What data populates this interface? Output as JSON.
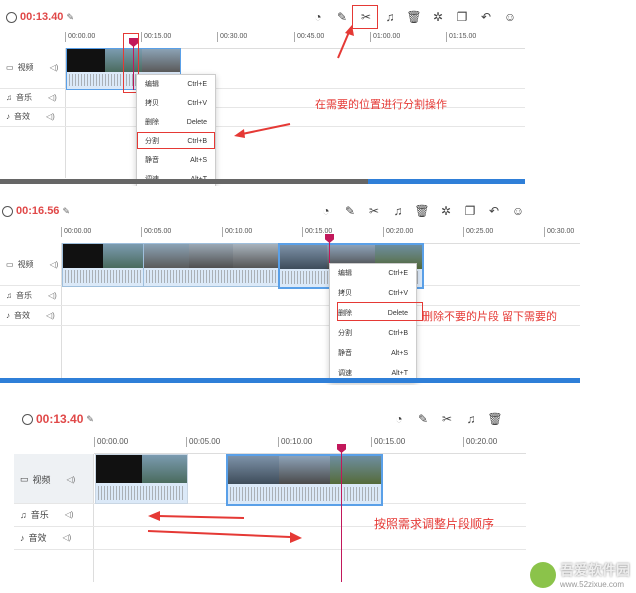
{
  "panel1": {
    "time": "00:13.40",
    "ticks": [
      "00:00.00",
      "00:15.00",
      "00:30.00",
      "00:45.00",
      "01:00.00",
      "01:15.00"
    ],
    "tracks": [
      {
        "label": "视频",
        "icon": "video-icon"
      },
      {
        "label": "音乐",
        "icon": "music-icon"
      },
      {
        "label": "音效",
        "icon": "sound-effect-icon"
      }
    ],
    "menu": [
      {
        "label": "编辑",
        "key": "Ctrl+E"
      },
      {
        "label": "拷贝",
        "key": "Ctrl+V"
      },
      {
        "label": "删除",
        "key": "Delete"
      },
      {
        "label": "分割",
        "key": "Ctrl+B"
      },
      {
        "label": "静音",
        "key": "Alt+S"
      },
      {
        "label": "调速",
        "key": "Alt+T"
      }
    ],
    "annotation": "在需要的位置进行分割操作"
  },
  "panel2": {
    "time": "00:16.56",
    "ticks": [
      "00:00.00",
      "00:05.00",
      "00:10.00",
      "00:15.00",
      "00:20.00",
      "00:25.00",
      "00:30.00"
    ],
    "tracks": [
      {
        "label": "视频",
        "icon": "video-icon"
      },
      {
        "label": "音乐",
        "icon": "music-icon"
      },
      {
        "label": "音效",
        "icon": "sound-effect-icon"
      }
    ],
    "menu": [
      {
        "label": "编辑",
        "key": "Ctrl+E"
      },
      {
        "label": "拷贝",
        "key": "Ctrl+V"
      },
      {
        "label": "删除",
        "key": "Delete"
      },
      {
        "label": "分割",
        "key": "Ctrl+B"
      },
      {
        "label": "静音",
        "key": "Alt+S"
      },
      {
        "label": "调速",
        "key": "Alt+T"
      }
    ],
    "annotation": "删除不要的片段 留下需要的"
  },
  "panel3": {
    "time": "00:13.40",
    "ticks": [
      "00:00.00",
      "00:05.00",
      "00:10.00",
      "00:15.00",
      "00:20.00"
    ],
    "tracks": [
      {
        "label": "视频",
        "icon": "video-icon"
      },
      {
        "label": "音乐",
        "icon": "music-icon"
      },
      {
        "label": "音效",
        "icon": "sound-effect-icon"
      }
    ],
    "annotation": "按照需求调整片段顺序"
  },
  "toolbar_icons": [
    "speed-icon",
    "edit-icon",
    "scissors-icon",
    "bell-icon",
    "trash-icon",
    "settings-icon",
    "copy-icon",
    "undo-icon",
    "sticker-icon"
  ],
  "watermark": {
    "name": "吾爱软件园",
    "url": "www.52zixue.com"
  },
  "colors": {
    "accent": "#e53935",
    "clip": "#5aa0e8",
    "playhead": "#c2185b",
    "scroll": "#2f7fd8"
  }
}
